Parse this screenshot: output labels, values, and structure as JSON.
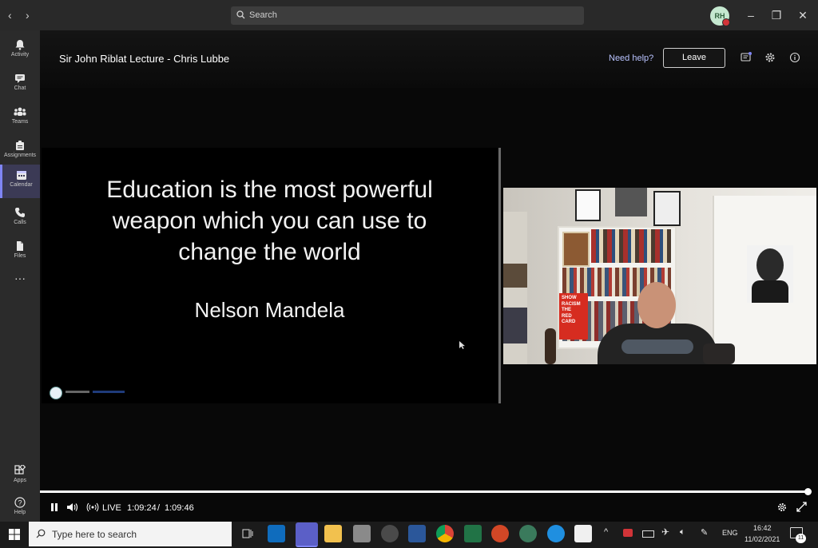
{
  "topbar": {
    "back": "‹",
    "forward": "›",
    "search_placeholder": "Search",
    "avatar_initials": "RH",
    "minimize": "–",
    "restore": "❐",
    "close": "✕"
  },
  "rail": {
    "items": [
      {
        "label": "Activity",
        "icon": "bell-icon"
      },
      {
        "label": "Chat",
        "icon": "chat-icon"
      },
      {
        "label": "Teams",
        "icon": "teams-icon"
      },
      {
        "label": "Assignments",
        "icon": "assignments-icon"
      },
      {
        "label": "Calendar",
        "icon": "calendar-icon",
        "active": true
      },
      {
        "label": "Calls",
        "icon": "phone-icon"
      },
      {
        "label": "Files",
        "icon": "file-icon"
      }
    ],
    "more": "···",
    "apps_label": "Apps",
    "help_label": "Help"
  },
  "meeting": {
    "title": "Sir John Riblat Lecture - Chris Lubbe",
    "need_help": "Need help?",
    "leave": "Leave"
  },
  "slide": {
    "quote_line1": "Education is the most powerful",
    "quote_line2": "weapon which you can use to",
    "quote_line3": "change the world",
    "author": "Nelson Mandela"
  },
  "camera": {
    "book_text1": "SHOW",
    "book_text2": "RACISM",
    "book_text3": "THE",
    "book_text4": "RED",
    "book_text5": "CARD"
  },
  "player": {
    "live_label": "LIVE",
    "current_time": "1:09:24",
    "separator": "/",
    "duration": "1:09:46",
    "progress": 1.0
  },
  "taskbar": {
    "search_placeholder": "Type here to search",
    "language": "ENG",
    "time": "16:42",
    "date": "11/02/2021",
    "notification_count": "11"
  },
  "colors": {
    "accent": "#7f85f5",
    "rail_bg": "#2b2b2b",
    "stage_bg": "#080808"
  }
}
